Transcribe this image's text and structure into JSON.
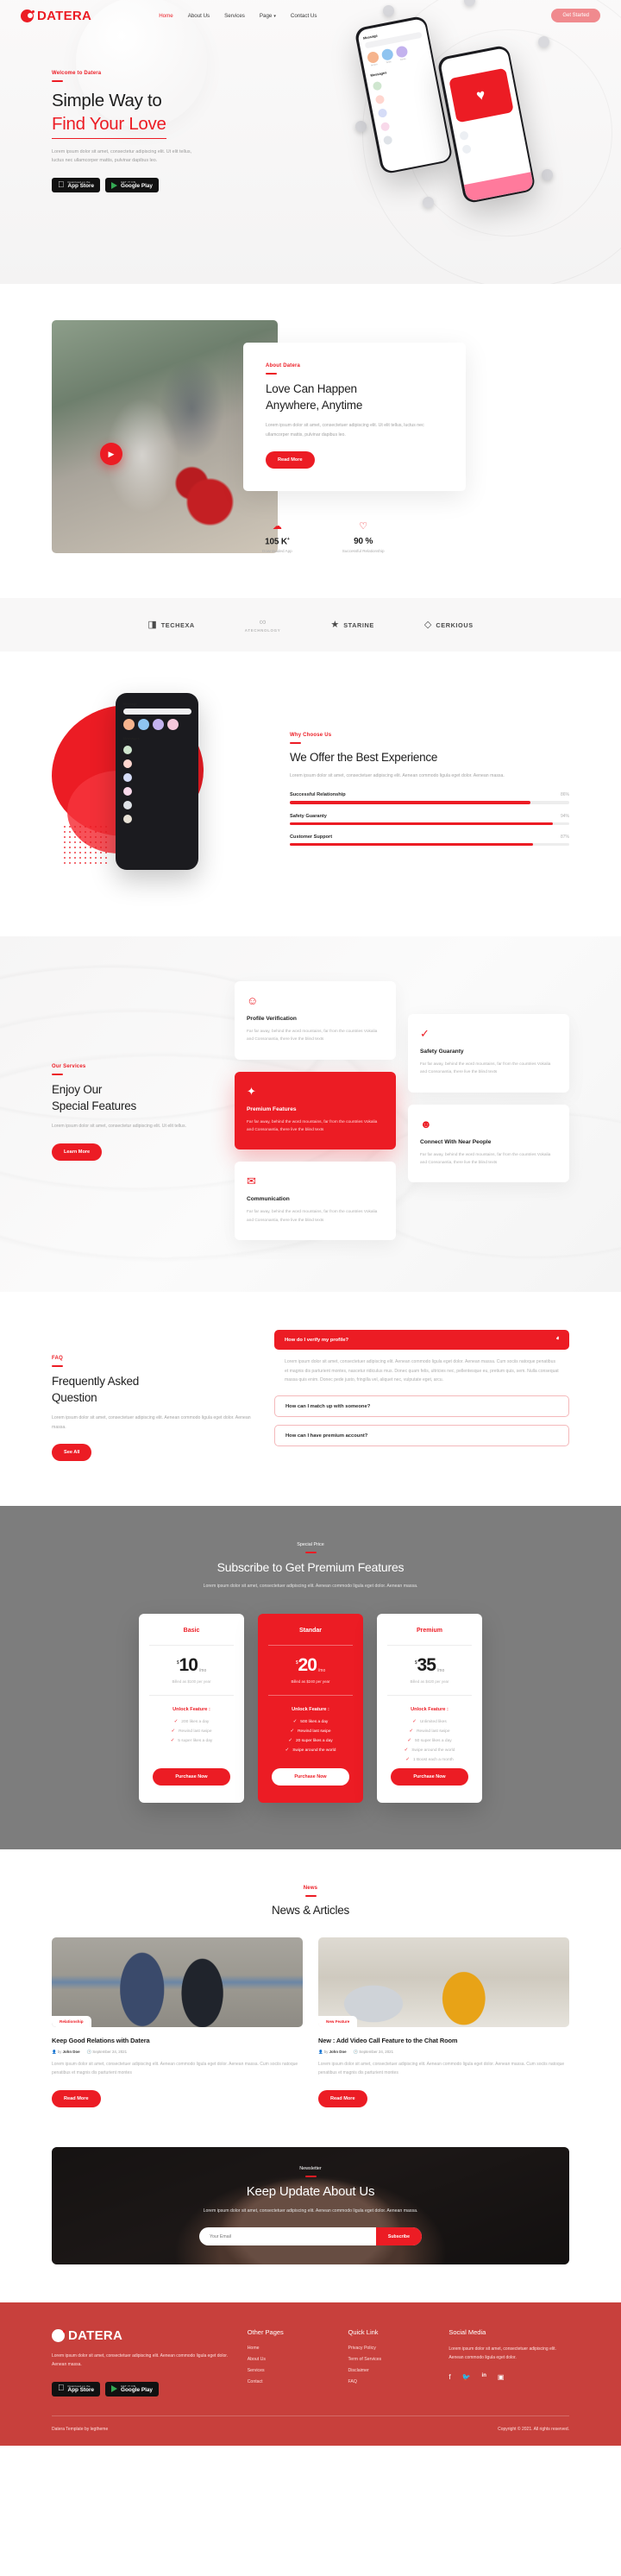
{
  "brand": {
    "name": "DATERA",
    "accent": "#ec1c24"
  },
  "nav": {
    "links": [
      {
        "label": "Home",
        "active": true
      },
      {
        "label": "About Us",
        "active": false
      },
      {
        "label": "Services",
        "active": false
      },
      {
        "label": "Page",
        "active": false,
        "caret": "▾"
      },
      {
        "label": "Contact Us",
        "active": false
      }
    ],
    "cta": "Get Started"
  },
  "hero": {
    "eyebrow": "Welcome to Datera",
    "title_line1": "Simple Way to",
    "title_line2": "Find Your Love",
    "paragraph": "Lorem ipsum dolor sit amet, consectetur adipiscing elit. Ut elit tellus, luctus nec ullamcorper mattis, pulvinar dapibus leo.",
    "appstore_small": "Download on the",
    "appstore_big": "App Store",
    "googleplay_small": "GET IT ON",
    "googleplay_big": "Google Play",
    "phone_msg_title": "Message",
    "phone_search_placeholder": "Search",
    "phone_section_title": "Messages",
    "phone_story_labels": [
      "Amara",
      "Tesla",
      "Jonas"
    ]
  },
  "about": {
    "eyebrow": "About Datera",
    "title_line1": "Love Can Happen",
    "title_line2": "Anywhere, Anytime",
    "paragraph": "Lorem ipsum dolor sit amet, consectetuer adipiscing elit. Ut elit tellus, luctus nec ullamcorper mattis, pulvinar dapibus leo.",
    "cta": "Read More",
    "stats": [
      {
        "icon": "cloud-download-icon",
        "glyph": "☁",
        "value": "105 K",
        "sup": "+",
        "caption": "Downloaded App"
      },
      {
        "icon": "heart-icon",
        "glyph": "♡",
        "value": "90 %",
        "sup": "",
        "caption": "Successful Relationship"
      }
    ]
  },
  "brands": [
    {
      "name": "TECHEXA",
      "glyph": "◨"
    },
    {
      "name": "ATECHNOLOGY",
      "glyph": "∞"
    },
    {
      "name": "STARINE",
      "glyph": "★"
    },
    {
      "name": "CERKIOUS",
      "glyph": "◇"
    }
  ],
  "why": {
    "eyebrow": "Why Choose Us",
    "title": "We Offer the Best Experience",
    "paragraph": "Lorem ipsum dolor sit amet, consectetuer adipiscing elit. Aenean commodo ligula eget dolor. Aenean massa.",
    "bars": [
      {
        "label": "Successful Relationship",
        "pct": "86%",
        "value": 86
      },
      {
        "label": "Safety Guaranty",
        "pct": "94%",
        "value": 94
      },
      {
        "label": "Customer Support",
        "pct": "87%",
        "value": 87
      }
    ]
  },
  "features": {
    "eyebrow": "Our Services",
    "title_line1": "Enjoy Our",
    "title_line2": "Special Features",
    "paragraph": "Lorem ipsum dolor sit amet, consectetur adipiscing elit. Ut elit tellus.",
    "cta": "Learn More",
    "body": "Far far away, behind the word mountains, far from the countries Vokalia and Consonantia, there live the blind texts",
    "cards": [
      {
        "title": "Profile Verification",
        "icon": "person-check-icon",
        "glyph": "☺",
        "highlight": false
      },
      {
        "title": "Premium Features",
        "icon": "badge-award-icon",
        "glyph": "✦",
        "highlight": true
      },
      {
        "title": "Communication",
        "icon": "chat-bubbles-icon",
        "glyph": "✉",
        "highlight": false
      },
      {
        "title": "Safety Guaranty",
        "icon": "shield-check-icon",
        "glyph": "✓",
        "highlight": false
      },
      {
        "title": "Connect With Near People",
        "icon": "people-location-icon",
        "glyph": "☻",
        "highlight": false
      }
    ]
  },
  "faq": {
    "eyebrow": "FAQ",
    "title_line1": "Frequently Asked",
    "title_line2": "Question",
    "paragraph": "Lorem ipsum dolor sit amet, consectetuer adipiscing elit. Aenean commodo ligula eget dolor. Aenean massa.",
    "cta": "See All",
    "items": [
      {
        "q": "How do I verify my profile?",
        "open": true,
        "chevron": "ⱏ",
        "a": "Lorem ipsum dolor sit amet, consectetuer adipiscing elit. Aenean commodo ligula eget dolor. Aenean massa. Cum sociis natoque penatibus et magnis dis parturient montes, nascetur ridiculus mus. Donec quam felis, ultricies nec, pellentesque eu, pretium quis, sem. Nulla consequat massa quis enim. Donec pede justo, fringilla vel, aliquet nec, vulputate eget, arcu."
      },
      {
        "q": "How can I match up with someone?",
        "open": false,
        "chevron": "ⱟ",
        "a": ""
      },
      {
        "q": "How can I have premium account?",
        "open": false,
        "chevron": "ⱟ",
        "a": ""
      }
    ]
  },
  "pricing": {
    "eyebrow": "Special Price",
    "title": "Subscribe to Get Premium Features",
    "paragraph": "Lorem ipsum dolor sit amet, consectetuer adipiscing elit. Aenean commodo ligula eget dolor. Aenean massa.",
    "unlock_label": "Unlock Feature :",
    "cta": "Purchase Now",
    "currency": "$",
    "period": "/mo",
    "plans": [
      {
        "name": "Basic",
        "price": "10",
        "billed": "Billed as $100 per year",
        "highlight": false,
        "features": [
          "200 likes a day",
          "Rewind last swipe",
          "5 super likes a day"
        ]
      },
      {
        "name": "Standar",
        "price": "20",
        "billed": "Billed as $240 per year",
        "highlight": true,
        "features": [
          "500 likes a day",
          "Rewind last swipe",
          "20 super likes a day",
          "Swipe around the world"
        ]
      },
      {
        "name": "Premium",
        "price": "35",
        "billed": "Billed as $420 per year",
        "highlight": false,
        "features": [
          "Unlimited likes",
          "Rewind last swipe",
          "50 super likes a day",
          "Swipe around the world",
          "1 Boost each a month"
        ]
      }
    ]
  },
  "news": {
    "eyebrow": "News",
    "title": "News & Articles",
    "cta": "Read More",
    "by_prefix": "by",
    "posts": [
      {
        "tag": "Relationship",
        "title": "Keep Good Relations with Datera",
        "author": "John Doe",
        "date": "September 24, 2021",
        "excerpt": "Lorem ipsum dolor sit amet, consectetuer adipiscing elit. Aenean commodo ligula eget dolor. Aenean massa. Cum sociis natoque penatibus et magnis dis parturient montes"
      },
      {
        "tag": "New Feature",
        "title": "New : Add Video Call Feature to the Chat Room",
        "author": "John Doe",
        "date": "September 24, 2021",
        "excerpt": "Lorem ipsum dolor sit amet, consectetuer adipiscing elit. Aenean commodo ligula eget dolor. Aenean massa. Cum sociis natoque penatibus et magnis dis parturient montes"
      }
    ]
  },
  "newsletter": {
    "eyebrow": "Newsletter",
    "title": "Keep Update About Us",
    "paragraph": "Lorem ipsum dolor sit amet, consectetuer adipiscing elit. Aenean commodo ligula eget dolor. Aenean massa.",
    "placeholder": "Your Email",
    "value": "",
    "cta": "Subscribe"
  },
  "footer": {
    "desc": "Lorem ipsum dolor sit amet, consectetuer adipiscing elit. Aenean commodo ligula eget dolor. Aenean massa.",
    "appstore_small": "Download on the",
    "appstore_big": "App Store",
    "googleplay_small": "GET IT ON",
    "googleplay_big": "Google Play",
    "col1": {
      "heading": "Other Pages",
      "links": [
        "Home",
        "About Us",
        "Services",
        "Contact"
      ]
    },
    "col2": {
      "heading": "Quick Link",
      "links": [
        "Privacy Policy",
        "Term of Services",
        "Disclaimer",
        "FAQ"
      ]
    },
    "col3": {
      "heading": "Social Media",
      "desc": "Lorem ipsum dolor sit amet, consectetuer adipiscing elit. Aenean commodo ligula eget dolor.",
      "icons": [
        {
          "name": "facebook-icon",
          "glyph": "f"
        },
        {
          "name": "twitter-icon",
          "glyph": "🐦"
        },
        {
          "name": "linkedin-icon",
          "glyph": "in"
        },
        {
          "name": "instagram-icon",
          "glyph": "▣"
        }
      ]
    },
    "credit": "Datera Template by legtheme",
    "copyright": "Copyright © 2021. All rights reserved."
  }
}
